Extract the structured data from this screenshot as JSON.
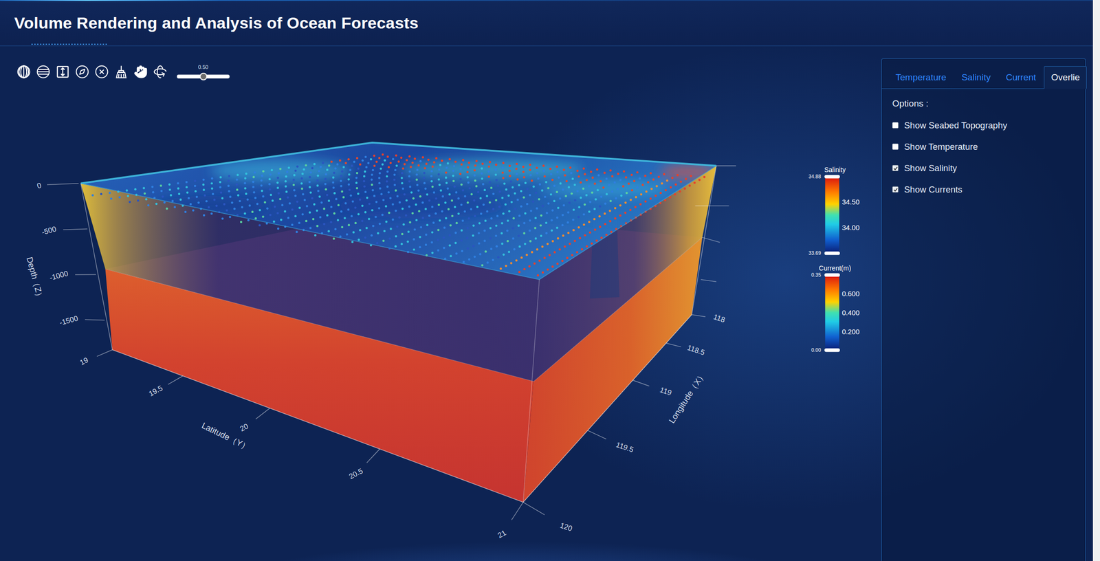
{
  "window": {
    "title": "Volume Rendering and Analysis of Ocean Forecasts"
  },
  "toolbar": {
    "opacity": {
      "level": 0.5,
      "reading": "0.50"
    }
  },
  "chart": {
    "axes": {
      "depth": {
        "title": "Depth（Z）",
        "ticks": [
          "0",
          "-500",
          "-1000",
          "-1500"
        ]
      },
      "latitude": {
        "title": "Latitude（Y）",
        "ticks": [
          "19",
          "19.5",
          "20",
          "20.5",
          "21"
        ]
      },
      "longitude": {
        "title": "Longitude（X）",
        "ticks": [
          "118",
          "118.5",
          "119",
          "119.5",
          "120"
        ]
      }
    },
    "legends": [
      {
        "title": "Salinity",
        "max": "34.88",
        "min": "33.69",
        "ticks": [
          "34.50",
          "34.00"
        ]
      },
      {
        "title": "Current(m)",
        "max": "0.35",
        "min": "0.00",
        "ticks": [
          "0.600",
          "0.400",
          "0.200"
        ]
      }
    ]
  },
  "panel": {
    "tabs": [
      {
        "label": "Temperature",
        "selected": false
      },
      {
        "label": "Salinity",
        "selected": false
      },
      {
        "label": "Current",
        "selected": false
      },
      {
        "label": "Overlie",
        "selected": true
      }
    ],
    "options_label": "Options :",
    "options": [
      {
        "label": "Show Seabed Topography",
        "checked": false
      },
      {
        "label": "Show Temperature",
        "checked": false
      },
      {
        "label": "Show Salinity",
        "checked": true
      },
      {
        "label": "Show Currents",
        "checked": true
      }
    ]
  }
}
